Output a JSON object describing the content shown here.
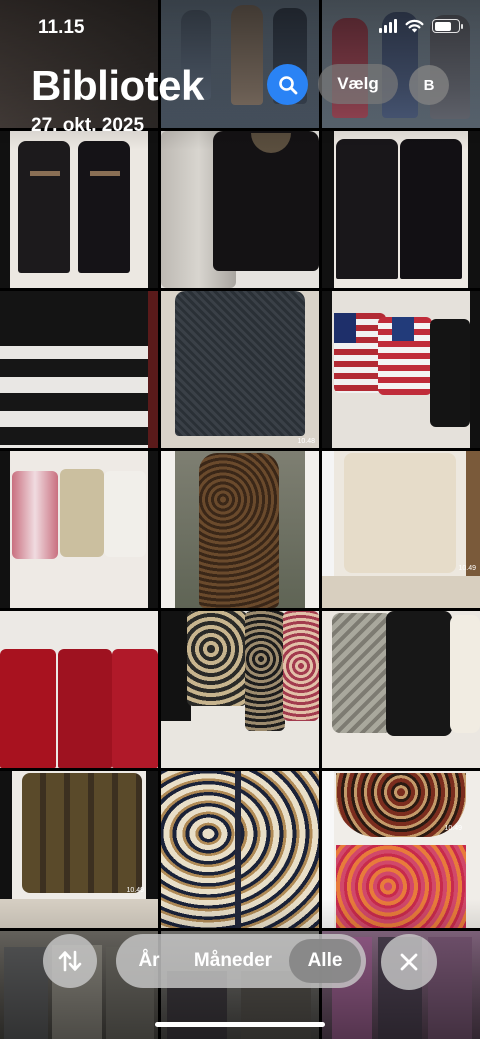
{
  "status_bar": {
    "time": "11.15",
    "icons": [
      "cellular-signal-icon",
      "wifi-icon",
      "battery-icon"
    ]
  },
  "header": {
    "title": "Bibliotek",
    "date": "27. okt. 2025",
    "search_icon": "search-icon",
    "select_label": "Vælg",
    "avatar_initial": "B"
  },
  "photos": [
    {
      "desc": "black dresses",
      "timestamp": ""
    },
    {
      "desc": "silver and black tops",
      "timestamp": ""
    },
    {
      "desc": "black dresses",
      "timestamp": ""
    },
    {
      "desc": "striped knit sweater",
      "timestamp": ""
    },
    {
      "desc": "dark crochet top",
      "timestamp": "10.48"
    },
    {
      "desc": "flag sweaters",
      "timestamp": ""
    },
    {
      "desc": "pink and beige cardigans",
      "timestamp": ""
    },
    {
      "desc": "leopard dress",
      "timestamp": ""
    },
    {
      "desc": "cream blouse",
      "timestamp": "10.49"
    },
    {
      "desc": "red tops",
      "timestamp": ""
    },
    {
      "desc": "patterned tops",
      "timestamp": ""
    },
    {
      "desc": "bird print blouses",
      "timestamp": ""
    },
    {
      "desc": "olive blouse",
      "timestamp": "10.49"
    },
    {
      "desc": "animal print blouse",
      "timestamp": ""
    },
    {
      "desc": "paisley skirt",
      "timestamp": "10.49"
    }
  ],
  "bottom_bar": {
    "sort_icon": "sort-arrows-icon",
    "segments": {
      "years": "År",
      "months": "Måneder",
      "all": "Alle"
    },
    "selected_segment": "Alle",
    "close_icon": "close-icon"
  },
  "colors": {
    "search_blue": "#2a83f5"
  }
}
